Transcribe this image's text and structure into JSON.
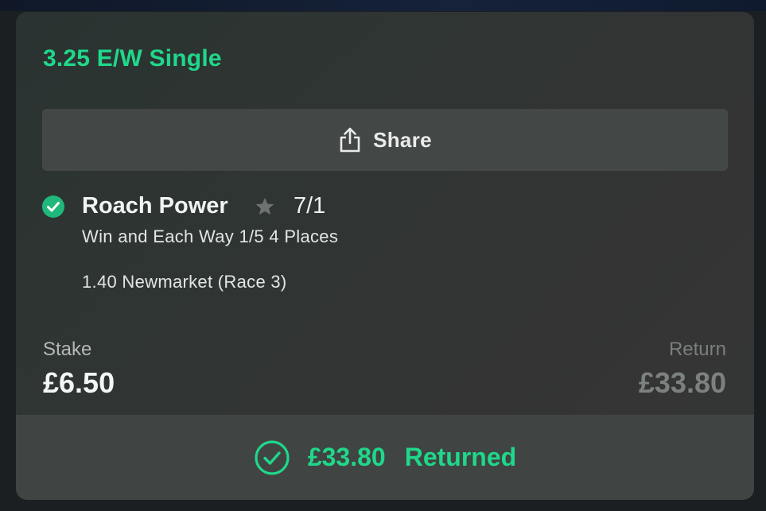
{
  "bet": {
    "title": "3.25 E/W Single"
  },
  "share": {
    "label": "Share",
    "icon": "share-icon"
  },
  "selection": {
    "runner": "Roach Power",
    "favourite_icon": "star-icon",
    "odds": "7/1",
    "market": "Win and Each Way 1/5 4 Places",
    "event": "1.40 Newmarket (Race 3)",
    "status_icon": "check-circle-icon"
  },
  "totals": {
    "stake_label": "Stake",
    "stake_value": "£6.50",
    "return_label": "Return",
    "return_value": "£33.80"
  },
  "result": {
    "amount": "£33.80",
    "text": "Returned",
    "icon": "check-outline-icon"
  },
  "colors": {
    "accent": "#1fd88a",
    "card_bg": "#2f3533",
    "button_bg": "#434746",
    "footer_bg": "#404443"
  }
}
